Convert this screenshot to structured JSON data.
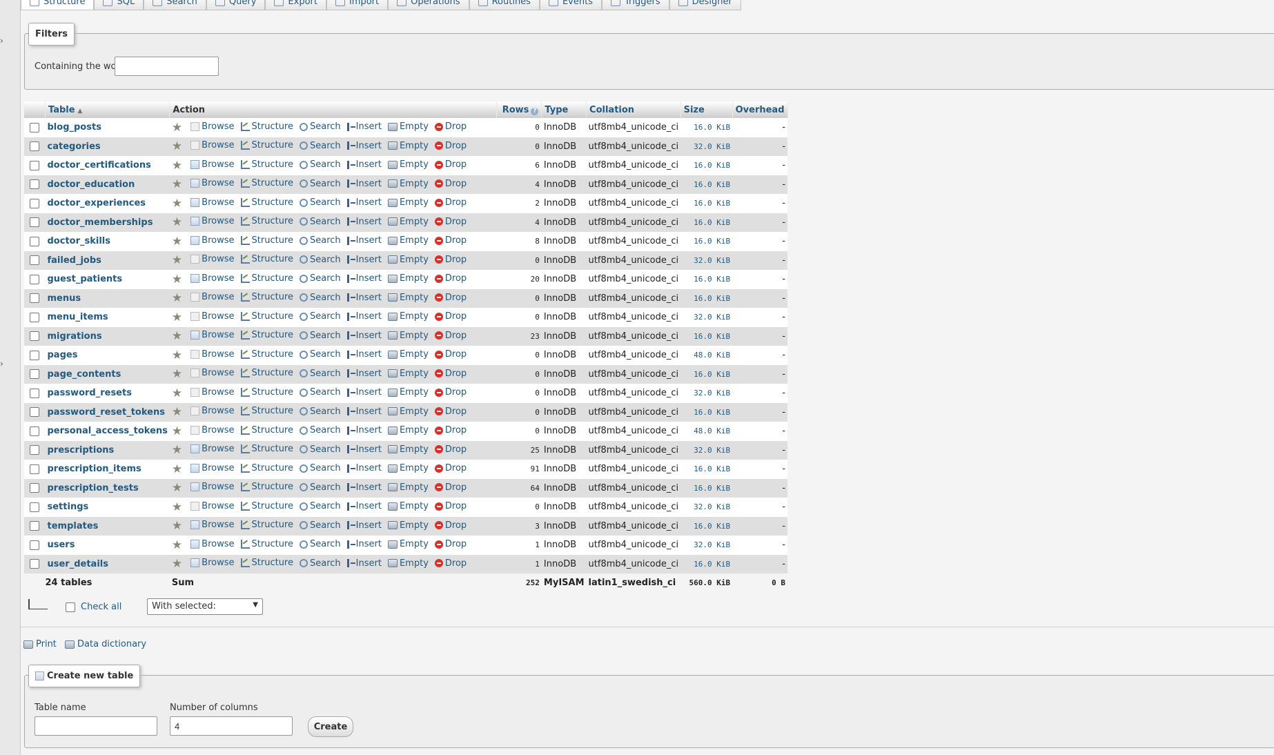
{
  "tabs": [
    {
      "label": "Structure",
      "active": true
    },
    {
      "label": "SQL"
    },
    {
      "label": "Search"
    },
    {
      "label": "Query"
    },
    {
      "label": "Export"
    },
    {
      "label": "Import"
    },
    {
      "label": "Operations"
    },
    {
      "label": "Routines"
    },
    {
      "label": "Events"
    },
    {
      "label": "Triggers"
    },
    {
      "label": "Designer"
    }
  ],
  "filters": {
    "legend": "Filters",
    "label": "Containing the word:",
    "value": ""
  },
  "headers": {
    "table": "Table",
    "action": "Action",
    "rows": "Rows",
    "type": "Type",
    "collation": "Collation",
    "size": "Size",
    "overhead": "Overhead"
  },
  "actions": {
    "browse": "Browse",
    "structure": "Structure",
    "search": "Search",
    "insert": "Insert",
    "empty": "Empty",
    "drop": "Drop"
  },
  "rows": [
    {
      "name": "blog_posts",
      "rows": "0",
      "type": "InnoDB",
      "collation": "utf8mb4_unicode_ci",
      "size": "16.0 KiB",
      "overhead": "-"
    },
    {
      "name": "categories",
      "rows": "0",
      "type": "InnoDB",
      "collation": "utf8mb4_unicode_ci",
      "size": "32.0 KiB",
      "overhead": "-"
    },
    {
      "name": "doctor_certifications",
      "rows": "6",
      "type": "InnoDB",
      "collation": "utf8mb4_unicode_ci",
      "size": "16.0 KiB",
      "overhead": "-"
    },
    {
      "name": "doctor_education",
      "rows": "4",
      "type": "InnoDB",
      "collation": "utf8mb4_unicode_ci",
      "size": "16.0 KiB",
      "overhead": "-"
    },
    {
      "name": "doctor_experiences",
      "rows": "2",
      "type": "InnoDB",
      "collation": "utf8mb4_unicode_ci",
      "size": "16.0 KiB",
      "overhead": "-"
    },
    {
      "name": "doctor_memberships",
      "rows": "4",
      "type": "InnoDB",
      "collation": "utf8mb4_unicode_ci",
      "size": "16.0 KiB",
      "overhead": "-"
    },
    {
      "name": "doctor_skills",
      "rows": "8",
      "type": "InnoDB",
      "collation": "utf8mb4_unicode_ci",
      "size": "16.0 KiB",
      "overhead": "-"
    },
    {
      "name": "failed_jobs",
      "rows": "0",
      "type": "InnoDB",
      "collation": "utf8mb4_unicode_ci",
      "size": "32.0 KiB",
      "overhead": "-"
    },
    {
      "name": "guest_patients",
      "rows": "20",
      "type": "InnoDB",
      "collation": "utf8mb4_unicode_ci",
      "size": "16.0 KiB",
      "overhead": "-"
    },
    {
      "name": "menus",
      "rows": "0",
      "type": "InnoDB",
      "collation": "utf8mb4_unicode_ci",
      "size": "16.0 KiB",
      "overhead": "-"
    },
    {
      "name": "menu_items",
      "rows": "0",
      "type": "InnoDB",
      "collation": "utf8mb4_unicode_ci",
      "size": "32.0 KiB",
      "overhead": "-"
    },
    {
      "name": "migrations",
      "rows": "23",
      "type": "InnoDB",
      "collation": "utf8mb4_unicode_ci",
      "size": "16.0 KiB",
      "overhead": "-"
    },
    {
      "name": "pages",
      "rows": "0",
      "type": "InnoDB",
      "collation": "utf8mb4_unicode_ci",
      "size": "48.0 KiB",
      "overhead": "-"
    },
    {
      "name": "page_contents",
      "rows": "0",
      "type": "InnoDB",
      "collation": "utf8mb4_unicode_ci",
      "size": "16.0 KiB",
      "overhead": "-"
    },
    {
      "name": "password_resets",
      "rows": "0",
      "type": "InnoDB",
      "collation": "utf8mb4_unicode_ci",
      "size": "32.0 KiB",
      "overhead": "-"
    },
    {
      "name": "password_reset_tokens",
      "rows": "0",
      "type": "InnoDB",
      "collation": "utf8mb4_unicode_ci",
      "size": "16.0 KiB",
      "overhead": "-"
    },
    {
      "name": "personal_access_tokens",
      "rows": "0",
      "type": "InnoDB",
      "collation": "utf8mb4_unicode_ci",
      "size": "48.0 KiB",
      "overhead": "-"
    },
    {
      "name": "prescriptions",
      "rows": "25",
      "type": "InnoDB",
      "collation": "utf8mb4_unicode_ci",
      "size": "32.0 KiB",
      "overhead": "-"
    },
    {
      "name": "prescription_items",
      "rows": "91",
      "type": "InnoDB",
      "collation": "utf8mb4_unicode_ci",
      "size": "16.0 KiB",
      "overhead": "-"
    },
    {
      "name": "prescription_tests",
      "rows": "64",
      "type": "InnoDB",
      "collation": "utf8mb4_unicode_ci",
      "size": "16.0 KiB",
      "overhead": "-"
    },
    {
      "name": "settings",
      "rows": "0",
      "type": "InnoDB",
      "collation": "utf8mb4_unicode_ci",
      "size": "32.0 KiB",
      "overhead": "-"
    },
    {
      "name": "templates",
      "rows": "3",
      "type": "InnoDB",
      "collation": "utf8mb4_unicode_ci",
      "size": "16.0 KiB",
      "overhead": "-"
    },
    {
      "name": "users",
      "rows": "1",
      "type": "InnoDB",
      "collation": "utf8mb4_unicode_ci",
      "size": "32.0 KiB",
      "overhead": "-"
    },
    {
      "name": "user_details",
      "rows": "1",
      "type": "InnoDB",
      "collation": "utf8mb4_unicode_ci",
      "size": "16.0 KiB",
      "overhead": "-"
    }
  ],
  "footer": {
    "tables": "24 tables",
    "sum": "Sum",
    "rows": "252",
    "type": "MyISAM",
    "collation": "latin1_swedish_ci",
    "size": "560.0 KiB",
    "overhead": "0 B"
  },
  "bulk": {
    "check_all": "Check all",
    "with_selected": "With selected:"
  },
  "links": {
    "print": "Print",
    "dictionary": "Data dictionary"
  },
  "create": {
    "legend": "Create new table",
    "name_label": "Table name",
    "name_value": "",
    "cols_label": "Number of columns",
    "cols_value": "4",
    "button": "Create"
  }
}
